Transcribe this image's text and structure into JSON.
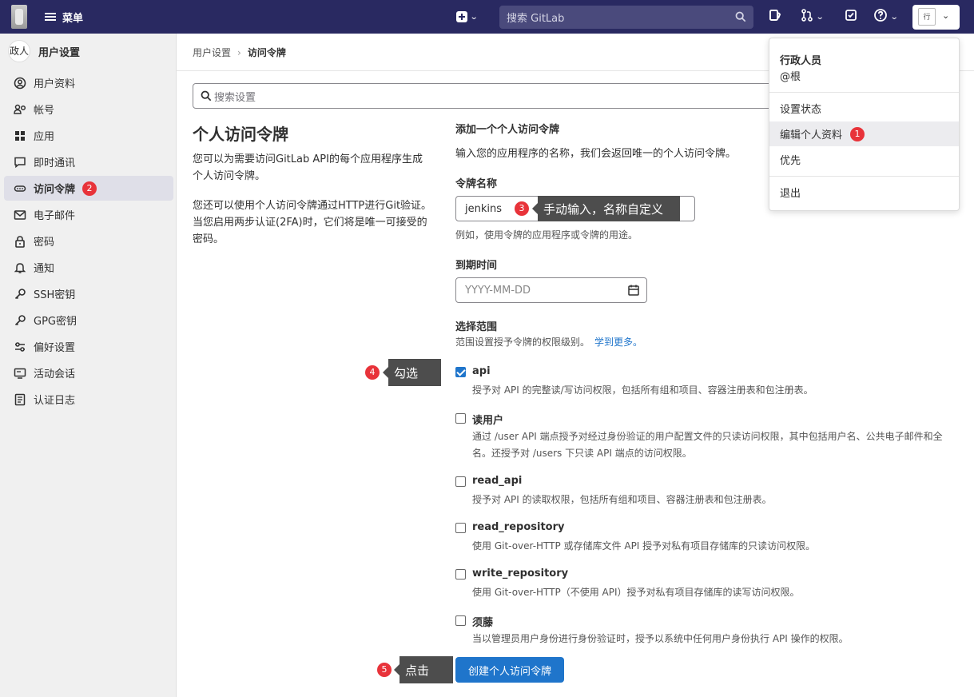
{
  "topbar": {
    "menu_label": "菜单",
    "search_placeholder": "搜索 GitLab",
    "avatar_alt": "行"
  },
  "sidebar": {
    "avatar_text": "政人",
    "title": "用户设置",
    "items": [
      {
        "label": "用户资料",
        "icon": "profile-icon"
      },
      {
        "label": "帐号",
        "icon": "account-icon"
      },
      {
        "label": "应用",
        "icon": "applications-icon"
      },
      {
        "label": "即时通讯",
        "icon": "chat-icon"
      },
      {
        "label": "访问令牌",
        "icon": "token-icon",
        "active": true
      },
      {
        "label": "电子邮件",
        "icon": "email-icon"
      },
      {
        "label": "密码",
        "icon": "lock-icon"
      },
      {
        "label": "通知",
        "icon": "bell-icon"
      },
      {
        "label": "SSH密钥",
        "icon": "key-icon"
      },
      {
        "label": "GPG密钥",
        "icon": "key-icon"
      },
      {
        "label": "偏好设置",
        "icon": "preferences-icon"
      },
      {
        "label": "活动会话",
        "icon": "monitor-icon"
      },
      {
        "label": "认证日志",
        "icon": "log-icon"
      }
    ]
  },
  "breadcrumb": {
    "parent": "用户设置",
    "current": "访问令牌"
  },
  "settings_search_placeholder": "搜索设置",
  "left": {
    "title": "个人访问令牌",
    "p1": "您可以为需要访问GitLab API的每个应用程序生成个人访问令牌。",
    "p2": "您还可以使用个人访问令牌通过HTTP进行Git验证。 当您启用两步认证(2FA)时，它们将是唯一可接受的密码。"
  },
  "form": {
    "heading": "添加一个个人访问令牌",
    "description": "输入您的应用程序的名称，我们会返回唯一的个人访问令牌。",
    "name_label": "令牌名称",
    "name_value": "jenkins",
    "name_help": "例如，使用令牌的应用程序或令牌的用途。",
    "expiry_label": "到期时间",
    "expiry_placeholder": "YYYY-MM-DD",
    "scopes_label": "选择范围",
    "scopes_help": "范围设置授予令牌的权限级别。",
    "learn_more": "学到更多。",
    "scopes": [
      {
        "name": "api",
        "checked": true,
        "desc": "授予对 API 的完整读/写访问权限，包括所有组和项目、容器注册表和包注册表。"
      },
      {
        "name": "读用户",
        "checked": false,
        "desc": "通过 /user API 端点授予对经过身份验证的用户配置文件的只读访问权限，其中包括用户名、公共电子邮件和全名。还授予对 /users 下只读 API 端点的访问权限。"
      },
      {
        "name": "read_api",
        "checked": false,
        "desc": "授予对 API 的读取权限，包括所有组和项目、容器注册表和包注册表。"
      },
      {
        "name": "read_repository",
        "checked": false,
        "desc": "使用 Git-over-HTTP 或存储库文件 API 授予对私有项目存储库的只读访问权限。"
      },
      {
        "name": "write_repository",
        "checked": false,
        "desc": "使用 Git-over-HTTP（不使用 API）授予对私有项目存储库的读写访问权限。"
      },
      {
        "name": "须藤",
        "checked": false,
        "desc": "当以管理员用户身份进行身份验证时，授予以系统中任何用户身份执行 API 操作的权限。"
      }
    ],
    "submit_label": "创建个人访问令牌"
  },
  "dropdown": {
    "name": "行政人员",
    "handle": "@根",
    "items": [
      "设置状态",
      "编辑个人资料",
      "优先"
    ],
    "signout": "退出"
  },
  "annotations": {
    "b1": "1",
    "b2": "2",
    "b3": "3",
    "b4": "4",
    "b5": "5",
    "tip3": "手动输入，名称自定义",
    "tip4": "勾选",
    "tip5": "点击"
  },
  "colors": {
    "topbar": "#292961",
    "primary": "#1f75cb",
    "badge": "#e8333a",
    "callout": "#4d4d4d"
  }
}
